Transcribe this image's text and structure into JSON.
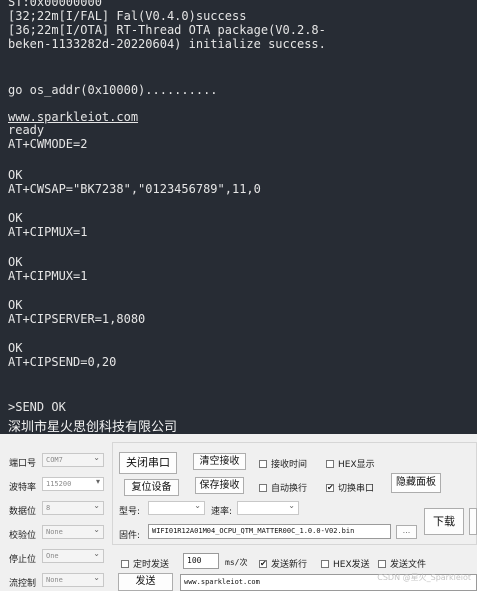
{
  "terminal": {
    "lines": [
      "ST:0x00000000",
      "[32;22m[I/FAL] Fal(V0.4.0)success",
      "[36;22m[I/OTA] RT-Thread OTA package(V0.2.8-",
      "beken-1133282d-20220604) initialize success.",
      "go os_addr(0x10000)..........",
      "www.sparkleiot.com",
      "ready",
      "AT+CWMODE=2",
      "OK",
      "AT+CWSAP=\"BK7238\",\"0123456789\",11,0",
      "OK",
      "AT+CIPMUX=1",
      "OK",
      "AT+CIPMUX=1",
      "OK",
      "AT+CIPSERVER=1,8080",
      "OK",
      "AT+CIPSEND=0,20",
      ">SEND OK"
    ],
    "banner": "深圳市星火思创科技有限公司"
  },
  "settings": {
    "port_label": "端口号",
    "port_value": "COM7",
    "baud_label": "波特率",
    "baud_value": "115200",
    "databits_label": "数据位",
    "databits_value": "8",
    "parity_label": "校验位",
    "parity_value": "None",
    "stopbits_label": "停止位",
    "stopbits_value": "One",
    "flow_label": "流控制",
    "flow_value": "None"
  },
  "controls": {
    "close_port": "关闭串口",
    "clear_recv": "清空接收",
    "recv_time": "接收时间",
    "hex_display": "HEX显示",
    "reset_device": "复位设备",
    "save_recv": "保存接收",
    "auto_wrap": "自动换行",
    "switch_port": "切换串口",
    "hide_panel": "隐藏面板",
    "model_label": "型号:",
    "speed_label": "速率:",
    "firmware_label": "固件:",
    "firmware_path": "WIFI01R12A01M04_OCPU_QTM_MATTER00C_1.0.0-V02.bin",
    "browse": "...",
    "download": "下载",
    "timed_send": "定时发送",
    "interval_value": "100",
    "interval_unit": "ms/次",
    "send_newline": "发送新行",
    "hex_send": "HEX发送",
    "send_file": "发送文件",
    "send": "发送",
    "send_text": "www.sparkleiot.com",
    "watermark": "CSDN @星火_Sparkleiot"
  }
}
